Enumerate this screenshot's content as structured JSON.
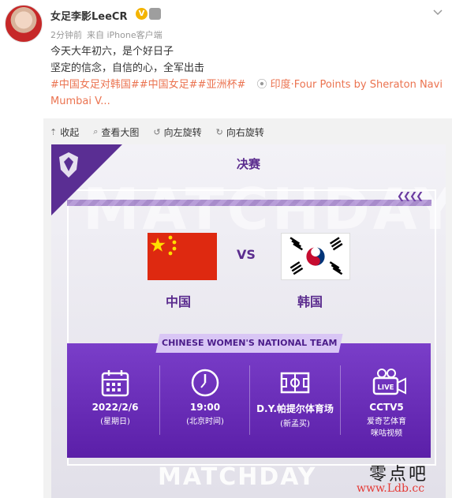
{
  "post": {
    "username": "女足李影LeeCR",
    "meta_time": "2分钟前",
    "meta_source": "来自 iPhone客户端",
    "text_lines": [
      "今天大年初六，是个好日子",
      "坚定的信念，自信的心，全军出击"
    ],
    "tags": "#中国女足对韩国##中国女足##亚洲杯#",
    "location": "印度·Four Points by Sheraton Navi",
    "location_cont": "Mumbai V..."
  },
  "toolbar": {
    "collapse": "收起",
    "view_large": "查看大图",
    "rotate_left": "向左旋转",
    "rotate_right": "向右旋转"
  },
  "poster": {
    "title": "决赛",
    "vs": "VS",
    "team_home": "中国",
    "team_away": "韩国",
    "tag": "CHINESE WOMEN'S NATIONAL TEAM",
    "date": "2022/2/6",
    "weekday": "(星期日)",
    "time": "19:00",
    "time_zone": "(北京时间)",
    "venue": "D.Y.帕提尔体育场",
    "venue_city": "(新孟买)",
    "broadcast_1": "CCTV5",
    "broadcast_2": "爱奇艺体育",
    "broadcast_3": "咪咕视频",
    "live": "LIVE",
    "matchday": "MATCHDAY"
  },
  "watermark": {
    "cn": "零点吧",
    "url": "www.Ldb.cc"
  },
  "colors": {
    "accent": "#eb7350",
    "purple": "#5b2c8e"
  }
}
